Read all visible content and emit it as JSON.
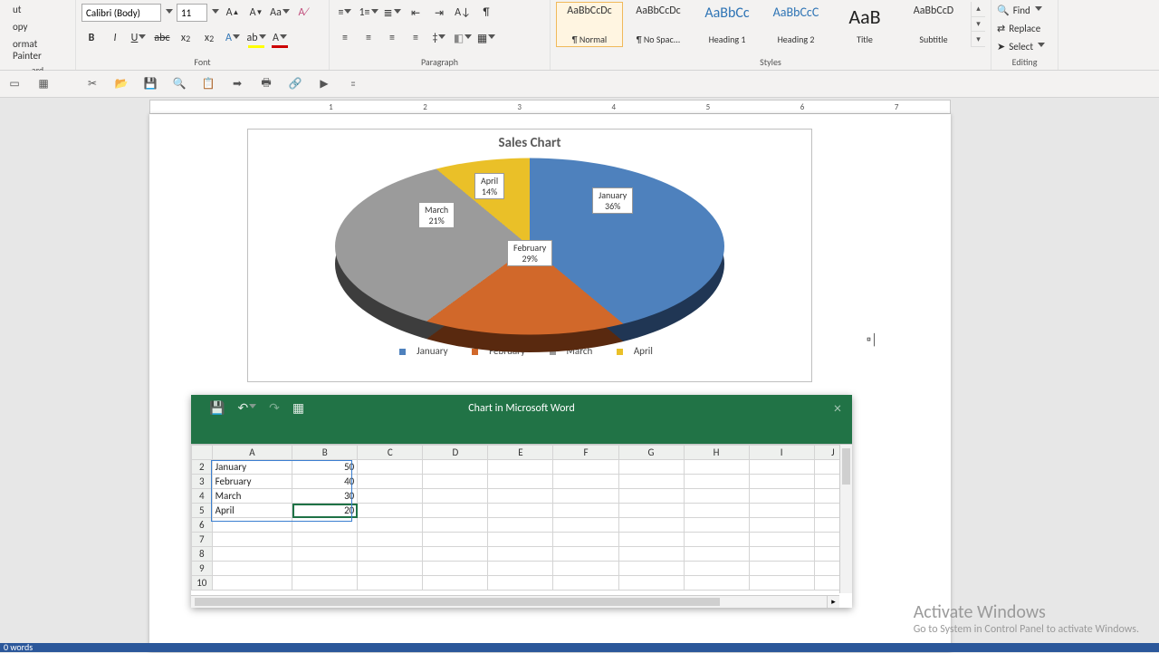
{
  "clipboard": {
    "cut": "ut",
    "copy": "opy",
    "painter": "ormat Painter",
    "group": "ard"
  },
  "font": {
    "name": "Calibri (Body)",
    "size": "11",
    "group": "Font"
  },
  "paragraph": {
    "group": "Paragraph"
  },
  "styles": {
    "group": "Styles",
    "items": [
      {
        "preview": "AaBbCcDc",
        "name": "¶ Normal",
        "cls": ""
      },
      {
        "preview": "AaBbCcDc",
        "name": "¶ No Spac...",
        "cls": ""
      },
      {
        "preview": "AaBbCc",
        "name": "Heading 1",
        "cls": "h1"
      },
      {
        "preview": "AaBbCcC",
        "name": "Heading 2",
        "cls": "h2"
      },
      {
        "preview": "AaB",
        "name": "Title",
        "cls": "title"
      },
      {
        "preview": "AaBbCcD",
        "name": "Subtitle",
        "cls": ""
      }
    ]
  },
  "editing": {
    "group": "Editing",
    "find": "Find",
    "replace": "Replace",
    "select": "Select"
  },
  "ruler": {
    "marks": [
      "1",
      "2",
      "3",
      "4",
      "5",
      "6",
      "7"
    ]
  },
  "chart_data": {
    "type": "pie",
    "title": "Sales Chart",
    "categories": [
      "January",
      "February",
      "March",
      "April"
    ],
    "values": [
      50,
      40,
      30,
      20
    ],
    "percent": [
      36,
      29,
      21,
      14
    ],
    "colors": [
      "#4e81bd",
      "#d1682a",
      "#9b9b9b",
      "#eac028"
    ],
    "legend": [
      "January",
      "February",
      "March",
      "April"
    ]
  },
  "excel": {
    "title": "Chart in Microsoft Word",
    "cols": [
      "A",
      "B",
      "C",
      "D",
      "E",
      "F",
      "G",
      "H",
      "I",
      "J"
    ],
    "rows": [
      {
        "n": "2",
        "a": "January",
        "b": "50"
      },
      {
        "n": "3",
        "a": "February",
        "b": "40"
      },
      {
        "n": "4",
        "a": "March",
        "b": "30"
      },
      {
        "n": "5",
        "a": "April",
        "b": "20"
      },
      {
        "n": "6",
        "a": "",
        "b": ""
      },
      {
        "n": "7",
        "a": "",
        "b": ""
      },
      {
        "n": "8",
        "a": "",
        "b": ""
      },
      {
        "n": "9",
        "a": "",
        "b": ""
      },
      {
        "n": "10",
        "a": "",
        "b": ""
      }
    ]
  },
  "watermark": {
    "title": "Activate Windows",
    "sub": "Go to System in Control Panel to activate Windows."
  },
  "status": {
    "words": "0 words"
  }
}
